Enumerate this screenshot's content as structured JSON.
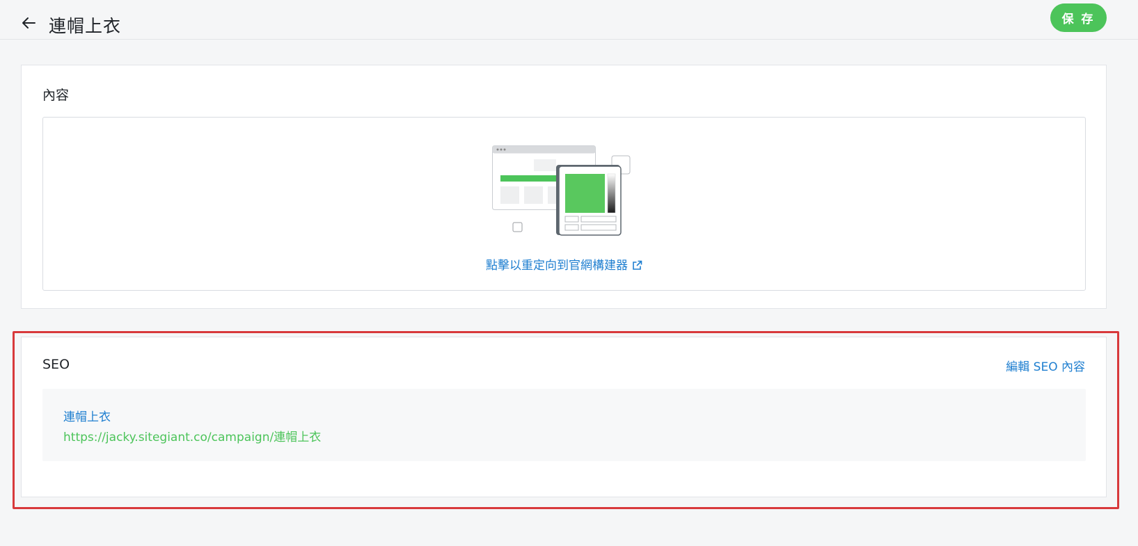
{
  "header": {
    "title": "連帽上衣",
    "save_label": "保 存",
    "back_icon": "arrow-left-icon"
  },
  "content_section": {
    "title": "內容",
    "builder_link_label": "點擊以重定向到官網構建器",
    "link_icon": "external-link-icon",
    "illustration": "site-builder-illustration"
  },
  "seo_section": {
    "title": "SEO",
    "edit_label": "編輯 SEO 內容",
    "preview": {
      "title": "連帽上衣",
      "url": "https://jacky.sitegiant.co/campaign/連帽上衣"
    }
  },
  "colors": {
    "accent_green": "#4cc45a",
    "link_blue": "#1f7fd0",
    "highlight_red": "#d8393b"
  }
}
